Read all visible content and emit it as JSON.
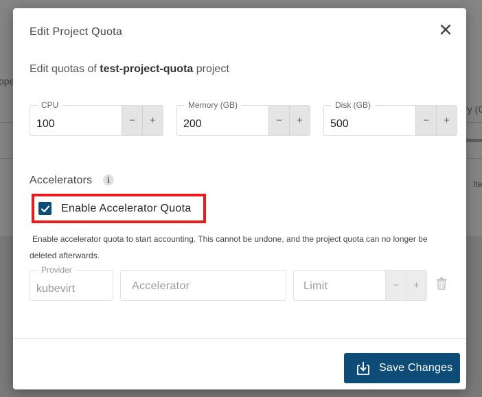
{
  "background": {
    "left_fragment": "ppe",
    "right_fragment": "ry (C",
    "right_fragment2": "Ite"
  },
  "modal": {
    "title": "Edit Project Quota",
    "subtitle_prefix": "Edit quotas of ",
    "project_name": "test-project-quota",
    "subtitle_suffix": " project"
  },
  "quotas": {
    "cpu": {
      "label": "CPU",
      "value": "100"
    },
    "memory": {
      "label": "Memory (GB)",
      "value": "200"
    },
    "disk": {
      "label": "Disk (GB)",
      "value": "500"
    },
    "decrement": "−",
    "increment": "+"
  },
  "accelerators": {
    "title": "Accelerators",
    "info_icon": "i",
    "checkbox_label": "Enable Accelerator Quota",
    "checkbox_checked": true,
    "help_text": "Enable accelerator quota to start accounting. This cannot be undone, and the project quota can no longer be deleted afterwards.",
    "provider": {
      "label": "Provider",
      "value": "kubevirt"
    },
    "accelerator_placeholder": "Accelerator",
    "limit_placeholder": "Limit"
  },
  "footer": {
    "save_label": "Save Changes"
  },
  "colors": {
    "primary": "#0d4c77",
    "highlight": "#ec1c1c"
  }
}
